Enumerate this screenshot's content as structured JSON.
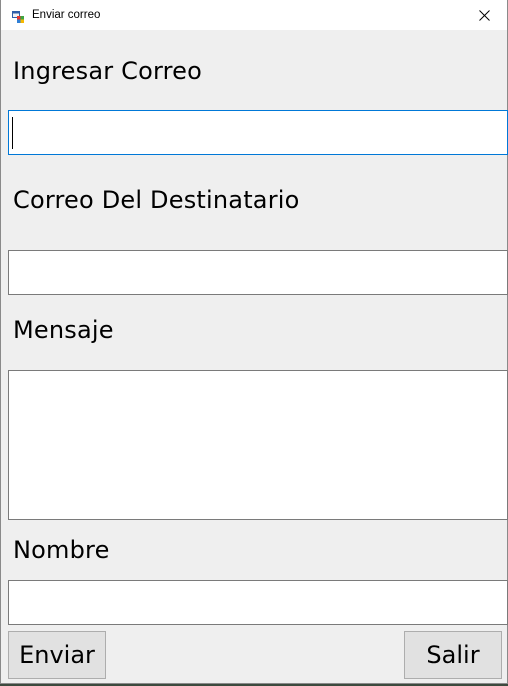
{
  "window": {
    "title": "Enviar correo",
    "icon": "windows-form-icon",
    "close_icon": "close-icon"
  },
  "form": {
    "sender_label": "Ingresar Correo",
    "sender_value": "",
    "recipient_label": "Correo Del Destinatario",
    "recipient_value": "",
    "message_label": "Mensaje",
    "message_value": "",
    "name_label": "Nombre",
    "name_value": ""
  },
  "buttons": {
    "send_label": "Enviar",
    "exit_label": "Salir"
  },
  "colors": {
    "form_background": "#efefef",
    "focus_border": "#0078d7",
    "button_background": "#e1e1e1"
  }
}
